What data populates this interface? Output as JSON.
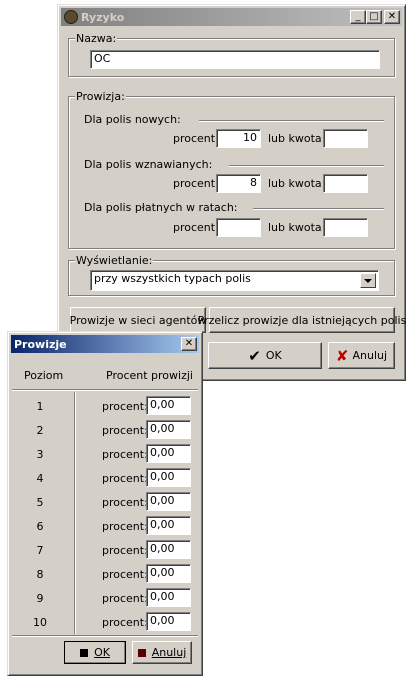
{
  "main_window": {
    "title": "Ryzyko",
    "nazwa": {
      "label": "Nazwa:",
      "value": "OC"
    },
    "prowizja": {
      "label": "Prowizja:",
      "sections": [
        {
          "label": "Dla polis nowych:",
          "procent_label": "procent:",
          "procent_value": "10",
          "kwota_label": "lub kwota:",
          "kwota_value": ""
        },
        {
          "label": "Dla polis wznawianych:",
          "procent_label": "procent:",
          "procent_value": "8",
          "kwota_label": "lub kwota:",
          "kwota_value": ""
        },
        {
          "label": "Dla polis płatnych w ratach:",
          "procent_label": "procent:",
          "procent_value": "",
          "kwota_label": "lub kwota:",
          "kwota_value": ""
        }
      ]
    },
    "wyswietlanie": {
      "label": "Wyświetlanie:",
      "selected": "przy wszystkich typach polis"
    },
    "buttons": {
      "agents": "Prowizje w sieci agentów",
      "recalc": "Przelicz prowizje dla istniejących polis",
      "ok": "OK",
      "cancel": "Anuluj"
    }
  },
  "dialog": {
    "title": "Prowizje",
    "headers": {
      "level": "Poziom",
      "percent": "Procent prowizji"
    },
    "rows": [
      {
        "level": "1",
        "label": "procent:",
        "value": "0,00"
      },
      {
        "level": "2",
        "label": "procent:",
        "value": "0,00"
      },
      {
        "level": "3",
        "label": "procent:",
        "value": "0,00"
      },
      {
        "level": "4",
        "label": "procent:",
        "value": "0,00"
      },
      {
        "level": "5",
        "label": "procent:",
        "value": "0,00"
      },
      {
        "level": "6",
        "label": "procent:",
        "value": "0,00"
      },
      {
        "level": "7",
        "label": "procent:",
        "value": "0,00"
      },
      {
        "level": "8",
        "label": "procent:",
        "value": "0,00"
      },
      {
        "level": "9",
        "label": "procent:",
        "value": "0,00"
      },
      {
        "level": "10",
        "label": "procent:",
        "value": "0,00"
      }
    ],
    "buttons": {
      "ok": "OK",
      "cancel": "Anuluj"
    }
  },
  "colors": {
    "face": "#d4d0c8",
    "active_title": "#0a246a",
    "inactive_title": "#808080",
    "cancel_icon": "#c00000"
  }
}
